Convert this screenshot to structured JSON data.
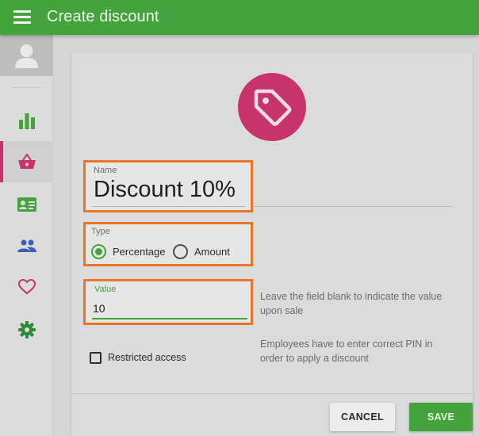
{
  "header": {
    "title": "Create discount",
    "menu_icon": "hamburger-menu-icon",
    "accent": "#44a33d"
  },
  "sidebar": {
    "items": [
      {
        "icon": "bar-chart-icon",
        "color": "#44a33d",
        "active": false
      },
      {
        "icon": "basket-icon",
        "color": "#c7346c",
        "active": true
      },
      {
        "icon": "id-card-icon",
        "color": "#44a33d",
        "active": false
      },
      {
        "icon": "people-icon",
        "color": "#3b5fb5",
        "active": false
      },
      {
        "icon": "heart-icon",
        "color": "#c7346c",
        "active": false
      },
      {
        "icon": "gear-icon",
        "color": "#2f8a3a",
        "active": false
      }
    ]
  },
  "form": {
    "icon": "tag-icon",
    "name": {
      "label": "Name",
      "value": "Discount 10%"
    },
    "type": {
      "label": "Type",
      "options": [
        "Percentage",
        "Amount"
      ],
      "selected": "Percentage"
    },
    "value": {
      "label": "Value",
      "value": "10",
      "hint": "Leave the field blank to indicate the value upon sale"
    },
    "restricted": {
      "label": "Restricted access",
      "checked": false,
      "hint": "Employees have to enter correct PIN in order to apply a discount"
    }
  },
  "actions": {
    "cancel": "CANCEL",
    "save": "SAVE"
  }
}
